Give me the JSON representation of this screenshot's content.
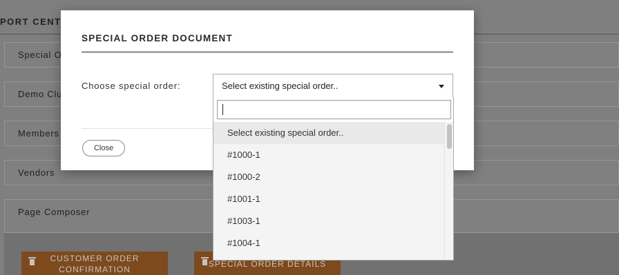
{
  "background": {
    "header_title": "PORT CENTE",
    "panels": [
      {
        "label": "Special O"
      },
      {
        "label": "Demo Clu"
      },
      {
        "label": "Members"
      },
      {
        "label": "Vendors"
      },
      {
        "label": "Page Composer"
      }
    ],
    "buttons": {
      "customer_order_line1": "CUSTOMER ORDER",
      "customer_order_line2": "CONFIRMATION",
      "special_order_details": "SPECIAL ORDER DETAILS"
    }
  },
  "modal": {
    "title": "SPECIAL ORDER DOCUMENT",
    "field_label": "Choose special order:",
    "select": {
      "selected": "Select existing special order..",
      "search_value": "",
      "options": [
        "Select existing special order..",
        "#1000-1",
        "#1000-2",
        "#1001-1",
        "#1003-1",
        "#1004-1"
      ]
    },
    "close_label": "Close"
  },
  "colors": {
    "overlay": "#7f7f7f",
    "accent_button": "#7d4a1e",
    "modal_bg": "#ffffff"
  },
  "icons": [
    "dropdown-arrow-icon",
    "trash-icon"
  ]
}
